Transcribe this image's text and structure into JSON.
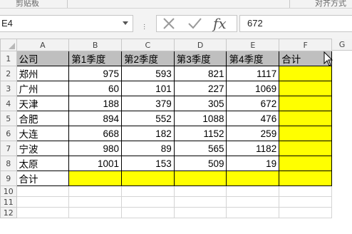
{
  "ribbon": {
    "left_label": "剪贴板",
    "right_label": "对齐方式"
  },
  "formula_bar": {
    "name_box": "E4",
    "cancel_icon": "cancel-icon",
    "enter_icon": "enter-icon",
    "fx_label": "fx",
    "value": "672"
  },
  "columns": [
    "A",
    "B",
    "C",
    "D",
    "E",
    "F",
    "G"
  ],
  "rows": [
    "1",
    "2",
    "3",
    "4",
    "5",
    "6",
    "7",
    "8",
    "9",
    "10",
    "11",
    "12"
  ],
  "table": {
    "headers": [
      "公司",
      "第1季度",
      "第2季度",
      "第3季度",
      "第4季度",
      "合计"
    ],
    "data": [
      [
        "郑州",
        "975",
        "593",
        "821",
        "1117",
        ""
      ],
      [
        "广州",
        "60",
        "101",
        "227",
        "1069",
        ""
      ],
      [
        "天津",
        "188",
        "379",
        "305",
        "672",
        ""
      ],
      [
        "合肥",
        "894",
        "552",
        "1088",
        "476",
        ""
      ],
      [
        "大连",
        "668",
        "182",
        "1152",
        "259",
        ""
      ],
      [
        "宁波",
        "980",
        "89",
        "565",
        "1182",
        ""
      ],
      [
        "太原",
        "1001",
        "153",
        "509",
        "19",
        ""
      ]
    ],
    "total_label": "合计"
  },
  "colors": {
    "header_fill": "#bfbfbf",
    "highlight_fill": "#ffff00",
    "grid_line": "#d4d4d4"
  }
}
